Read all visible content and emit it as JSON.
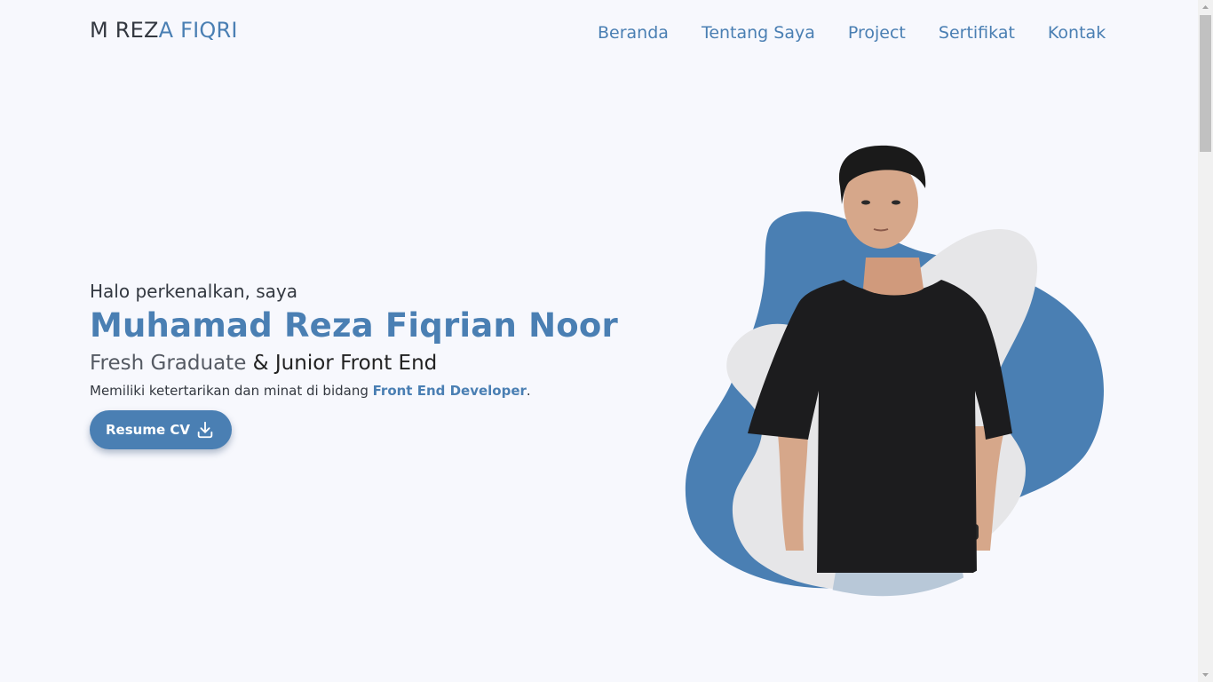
{
  "navbar": {
    "brand_main": "M REZ",
    "brand_accent": "A FIQRI",
    "links": [
      {
        "label": "Beranda"
      },
      {
        "label": "Tentang Saya"
      },
      {
        "label": "Project"
      },
      {
        "label": "Sertifikat"
      },
      {
        "label": "Kontak"
      }
    ]
  },
  "hero": {
    "greeting": "Halo perkenalkan, saya",
    "name": "Muhamad Reza Fiqrian Noor",
    "role_part1": "Fresh Graduate",
    "role_part2": " & Junior Front End",
    "desc_prefix": "Memiliki ketertarikan dan minat di bidang ",
    "desc_highlight": "Front End Developer",
    "desc_suffix": ".",
    "cta_label": "Resume CV",
    "cta_icon": "download-icon"
  },
  "colors": {
    "accent": "#4a7fb3",
    "background": "#f7f8fd",
    "text": "#333840",
    "blob_grey": "#e6e6e8"
  }
}
